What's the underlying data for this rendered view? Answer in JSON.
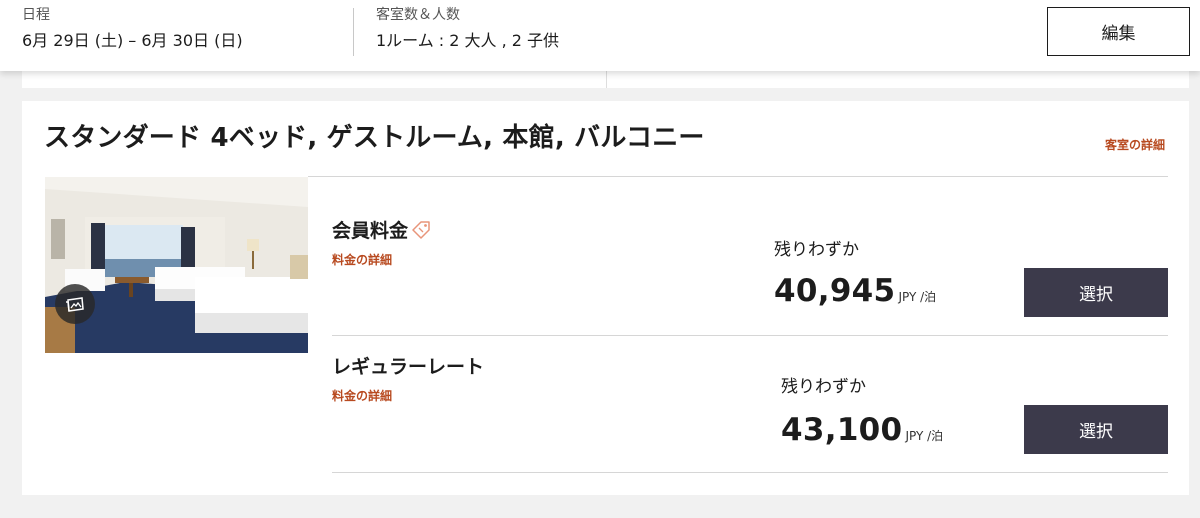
{
  "summary": {
    "dates_label": "日程",
    "dates_value": "6月 29日 (土) – 6月 30日 (日)",
    "rooms_label": "客室数＆人数",
    "rooms_value": "1ルーム : 2 大人 , 2 子供",
    "edit_label": "編集"
  },
  "room": {
    "title": "スタンダード 4ベッド, ゲストルーム, 本館, バルコニー",
    "details_link": "客室の詳細",
    "photo_icon": "gallery-icon",
    "rates": [
      {
        "name": "会員料金",
        "has_tag_icon": true,
        "details_link": "料金の詳細",
        "availability": "残りわずか",
        "price": "40,945",
        "unit": "JPY /泊",
        "select_label": "選択"
      },
      {
        "name": "レギュラーレート",
        "has_tag_icon": false,
        "details_link": "料金の詳細",
        "availability": "残りわずか",
        "price": "43,100",
        "unit": "JPY /泊",
        "select_label": "選択"
      }
    ]
  },
  "colors": {
    "accent_link": "#b84a20",
    "select_button": "#3c3a4b",
    "page_bg": "#f1f1f1"
  }
}
